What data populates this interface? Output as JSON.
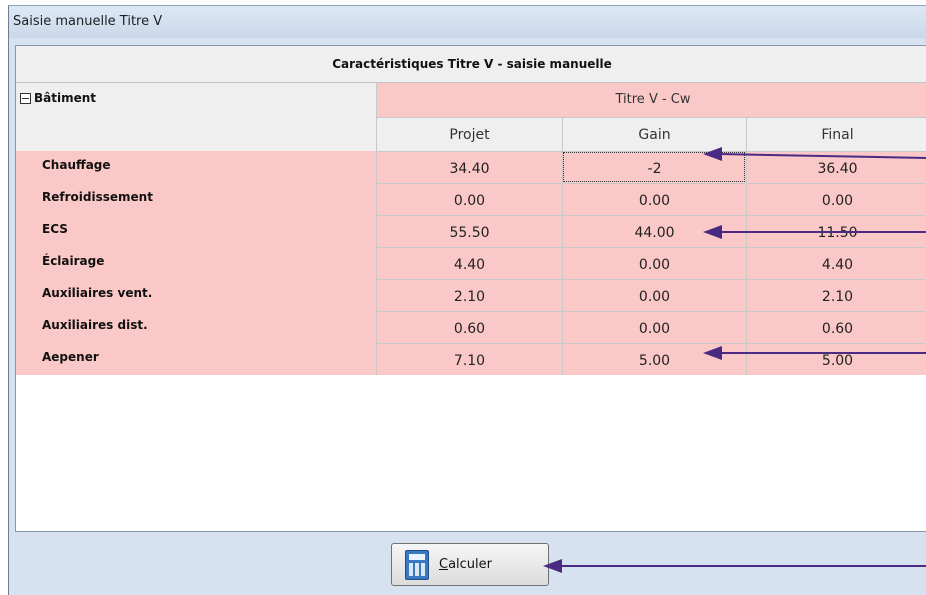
{
  "window": {
    "title": "Saisie manuelle Titre V"
  },
  "grid": {
    "header": "Caractéristiques Titre V - saisie manuelle",
    "group_label": "Bâtiment",
    "band_title": "Titre V - Cw",
    "columns": [
      "Projet",
      "Gain",
      "Final"
    ],
    "rows": [
      {
        "label": "Chauffage",
        "projet": "34.40",
        "gain": "-2",
        "final": "36.40"
      },
      {
        "label": "Refroidissement",
        "projet": "0.00",
        "gain": "0.00",
        "final": "0.00"
      },
      {
        "label": "ECS",
        "projet": "55.50",
        "gain": "44.00",
        "final": "11.50"
      },
      {
        "label": "Éclairage",
        "projet": "4.40",
        "gain": "0.00",
        "final": "4.40"
      },
      {
        "label": "Auxiliaires vent.",
        "projet": "2.10",
        "gain": "0.00",
        "final": "2.10"
      },
      {
        "label": "Auxiliaires dist.",
        "projet": "0.60",
        "gain": "0.00",
        "final": "0.60"
      },
      {
        "label": "Aepener",
        "projet": "7.10",
        "gain": "5.00",
        "final": "5.00"
      }
    ]
  },
  "button": {
    "mnemonic": "C",
    "label_rest": "alculer"
  },
  "colors": {
    "row_background": "#fbc8c8",
    "annotation_arrow": "#4b2a83",
    "window_background": "#d6e2f0"
  },
  "icons": {
    "calculate": "calculator-icon",
    "collapse": "collapse-minus-icon"
  }
}
